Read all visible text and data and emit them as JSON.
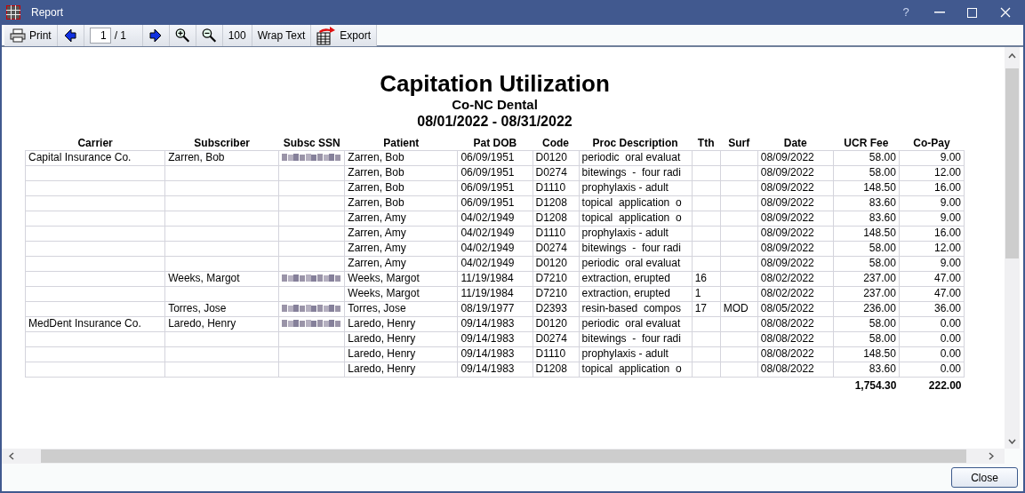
{
  "window": {
    "title": "Report",
    "help": "?"
  },
  "toolbar": [
    {
      "kind": "print",
      "label": "Print"
    },
    {
      "kind": "prev"
    },
    {
      "kind": "page",
      "value": "1",
      "total": "/ 1"
    },
    {
      "kind": "next"
    },
    {
      "kind": "zoom_in"
    },
    {
      "kind": "zoom_out"
    },
    {
      "kind": "text",
      "label": "100"
    },
    {
      "kind": "text",
      "label": "Wrap Text"
    },
    {
      "kind": "export",
      "label": "Export"
    }
  ],
  "report": {
    "title": "Capitation Utilization",
    "subtitle": "Co-NC Dental",
    "date_range": "08/01/2022 - 08/31/2022",
    "columns": [
      "Carrier",
      "Subscriber",
      "Subsc SSN",
      "Patient",
      "Pat DOB",
      "Code",
      "Proc Description",
      "Tth",
      "Surf",
      "Date",
      "UCR Fee",
      "Co-Pay"
    ],
    "rows": [
      {
        "carrier": "Capital Insurance Co.",
        "subscriber": "Zarren, Bob",
        "ssn_blurred": true,
        "patient": "Zarren, Bob",
        "pat_dob": "06/09/1951",
        "code": "D0120",
        "proc_description": "periodic  oral evaluat",
        "date": "08/09/2022",
        "ucr_fee": "58.00",
        "co_pay": "9.00"
      },
      {
        "ssn_blurred": false,
        "patient": "Zarren, Bob",
        "pat_dob": "06/09/1951",
        "code": "D0274",
        "proc_description": "bitewings  -  four radi",
        "date": "08/09/2022",
        "ucr_fee": "58.00",
        "co_pay": "12.00"
      },
      {
        "ssn_blurred": false,
        "patient": "Zarren, Bob",
        "pat_dob": "06/09/1951",
        "code": "D1110",
        "proc_description": "prophylaxis - adult",
        "date": "08/09/2022",
        "ucr_fee": "148.50",
        "co_pay": "16.00"
      },
      {
        "ssn_blurred": false,
        "patient": "Zarren, Bob",
        "pat_dob": "06/09/1951",
        "code": "D1208",
        "proc_description": "topical  application  o",
        "date": "08/09/2022",
        "ucr_fee": "83.60",
        "co_pay": "9.00"
      },
      {
        "ssn_blurred": false,
        "patient": "Zarren, Amy",
        "pat_dob": "04/02/1949",
        "code": "D1208",
        "proc_description": "topical  application  o",
        "date": "08/09/2022",
        "ucr_fee": "83.60",
        "co_pay": "9.00"
      },
      {
        "ssn_blurred": false,
        "patient": "Zarren, Amy",
        "pat_dob": "04/02/1949",
        "code": "D1110",
        "proc_description": "prophylaxis - adult",
        "date": "08/09/2022",
        "ucr_fee": "148.50",
        "co_pay": "16.00"
      },
      {
        "ssn_blurred": false,
        "patient": "Zarren, Amy",
        "pat_dob": "04/02/1949",
        "code": "D0274",
        "proc_description": "bitewings  -  four radi",
        "date": "08/09/2022",
        "ucr_fee": "58.00",
        "co_pay": "12.00"
      },
      {
        "ssn_blurred": false,
        "patient": "Zarren, Amy",
        "pat_dob": "04/02/1949",
        "code": "D0120",
        "proc_description": "periodic  oral evaluat",
        "date": "08/09/2022",
        "ucr_fee": "58.00",
        "co_pay": "9.00"
      },
      {
        "subscriber": "Weeks, Margot",
        "ssn_blurred": true,
        "patient": "Weeks, Margot",
        "pat_dob": "11/19/1984",
        "code": "D7210",
        "proc_description": "extraction, erupted",
        "tth": "16",
        "date": "08/02/2022",
        "ucr_fee": "237.00",
        "co_pay": "47.00"
      },
      {
        "ssn_blurred": false,
        "patient": "Weeks, Margot",
        "pat_dob": "11/19/1984",
        "code": "D7210",
        "proc_description": "extraction, erupted",
        "tth": "1",
        "date": "08/02/2022",
        "ucr_fee": "237.00",
        "co_pay": "47.00"
      },
      {
        "subscriber": "Torres, Jose",
        "ssn_blurred": true,
        "patient": "Torres, Jose",
        "pat_dob": "08/19/1977",
        "code": "D2393",
        "proc_description": "resin-based  compos",
        "tth": "17",
        "surf": "MOD",
        "date": "08/05/2022",
        "ucr_fee": "236.00",
        "co_pay": "36.00"
      },
      {
        "carrier": "MedDent Insurance Co.",
        "subscriber": "Laredo, Henry",
        "ssn_blurred": true,
        "patient": "Laredo, Henry",
        "pat_dob": "09/14/1983",
        "code": "D0120",
        "proc_description": "periodic  oral evaluat",
        "date": "08/08/2022",
        "ucr_fee": "58.00",
        "co_pay": "0.00"
      },
      {
        "ssn_blurred": false,
        "patient": "Laredo, Henry",
        "pat_dob": "09/14/1983",
        "code": "D0274",
        "proc_description": "bitewings  -  four radi",
        "date": "08/08/2022",
        "ucr_fee": "58.00",
        "co_pay": "0.00"
      },
      {
        "ssn_blurred": false,
        "patient": "Laredo, Henry",
        "pat_dob": "09/14/1983",
        "code": "D1110",
        "proc_description": "prophylaxis - adult",
        "date": "08/08/2022",
        "ucr_fee": "148.50",
        "co_pay": "0.00"
      },
      {
        "ssn_blurred": false,
        "patient": "Laredo, Henry",
        "pat_dob": "09/14/1983",
        "code": "D1208",
        "proc_description": "topical  application  o",
        "date": "08/08/2022",
        "ucr_fee": "83.60",
        "co_pay": "0.00"
      }
    ],
    "totals": {
      "ucr_fee": "1,754.30",
      "co_pay": "222.00"
    }
  },
  "footer": {
    "close": "Close"
  }
}
